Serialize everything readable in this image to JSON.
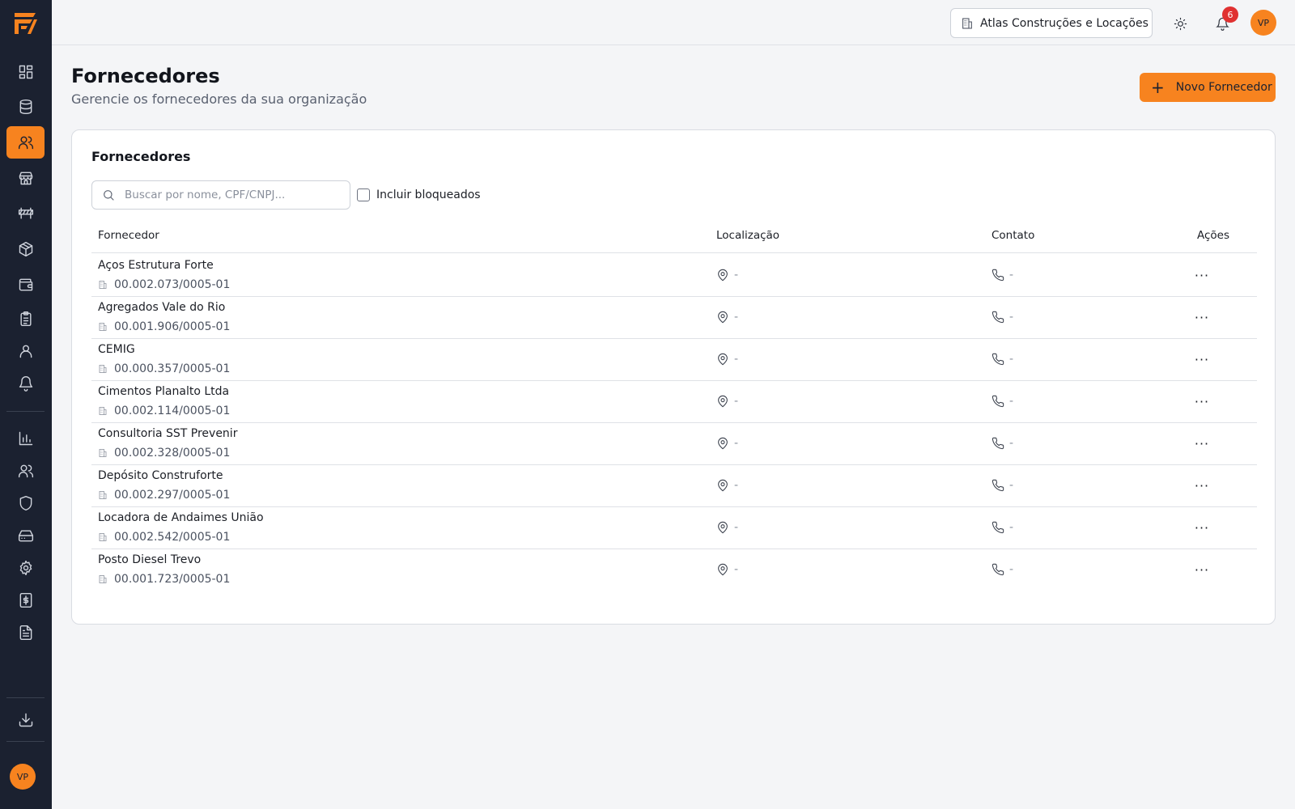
{
  "sidebar": {
    "brand_color": "#f7831f",
    "nav_icons": [
      "dashboard-icon",
      "database-icon",
      "users-icon",
      "store-icon",
      "roadblock-icon",
      "box-icon",
      "wallet-icon",
      "clipboard-icon",
      "user-icon",
      "bell-icon",
      "bar-chart-icon",
      "team-icon",
      "shield-icon",
      "drive-icon",
      "gear-icon",
      "receipt-icon",
      "document-icon",
      "download-icon"
    ],
    "active_index": 2,
    "avatar_initials": "VP"
  },
  "topbar": {
    "organization": "Atlas Construções e Locações",
    "notification_count": "6",
    "avatar_initials": "VP"
  },
  "header": {
    "title": "Fornecedores",
    "subtitle": "Gerencie os fornecedores da sua organização",
    "new_button_label": "Novo Fornecedor"
  },
  "card": {
    "title": "Fornecedores",
    "search_placeholder": "Buscar por nome, CPF/CNPJ...",
    "include_blocked_label": "Incluir bloqueados",
    "columns": {
      "supplier": "Fornecedor",
      "location": "Localização",
      "contact": "Contato",
      "actions": "Ações"
    },
    "rows": [
      {
        "name": "Aços Estrutura Forte",
        "document": "00.002.073/0005-01",
        "location": "-",
        "contact": "-"
      },
      {
        "name": "Agregados Vale do Rio",
        "document": "00.001.906/0005-01",
        "location": "-",
        "contact": "-"
      },
      {
        "name": "CEMIG",
        "document": "00.000.357/0005-01",
        "location": "-",
        "contact": "-"
      },
      {
        "name": "Cimentos Planalto Ltda",
        "document": "00.002.114/0005-01",
        "location": "-",
        "contact": "-"
      },
      {
        "name": "Consultoria SST Prevenir",
        "document": "00.002.328/0005-01",
        "location": "-",
        "contact": "-"
      },
      {
        "name": "Depósito Construforte",
        "document": "00.002.297/0005-01",
        "location": "-",
        "contact": "-"
      },
      {
        "name": "Locadora de Andaimes União",
        "document": "00.002.542/0005-01",
        "location": "-",
        "contact": "-"
      },
      {
        "name": "Posto Diesel Trevo",
        "document": "00.001.723/0005-01",
        "location": "-",
        "contact": "-"
      }
    ],
    "row_action_glyph": "···"
  }
}
